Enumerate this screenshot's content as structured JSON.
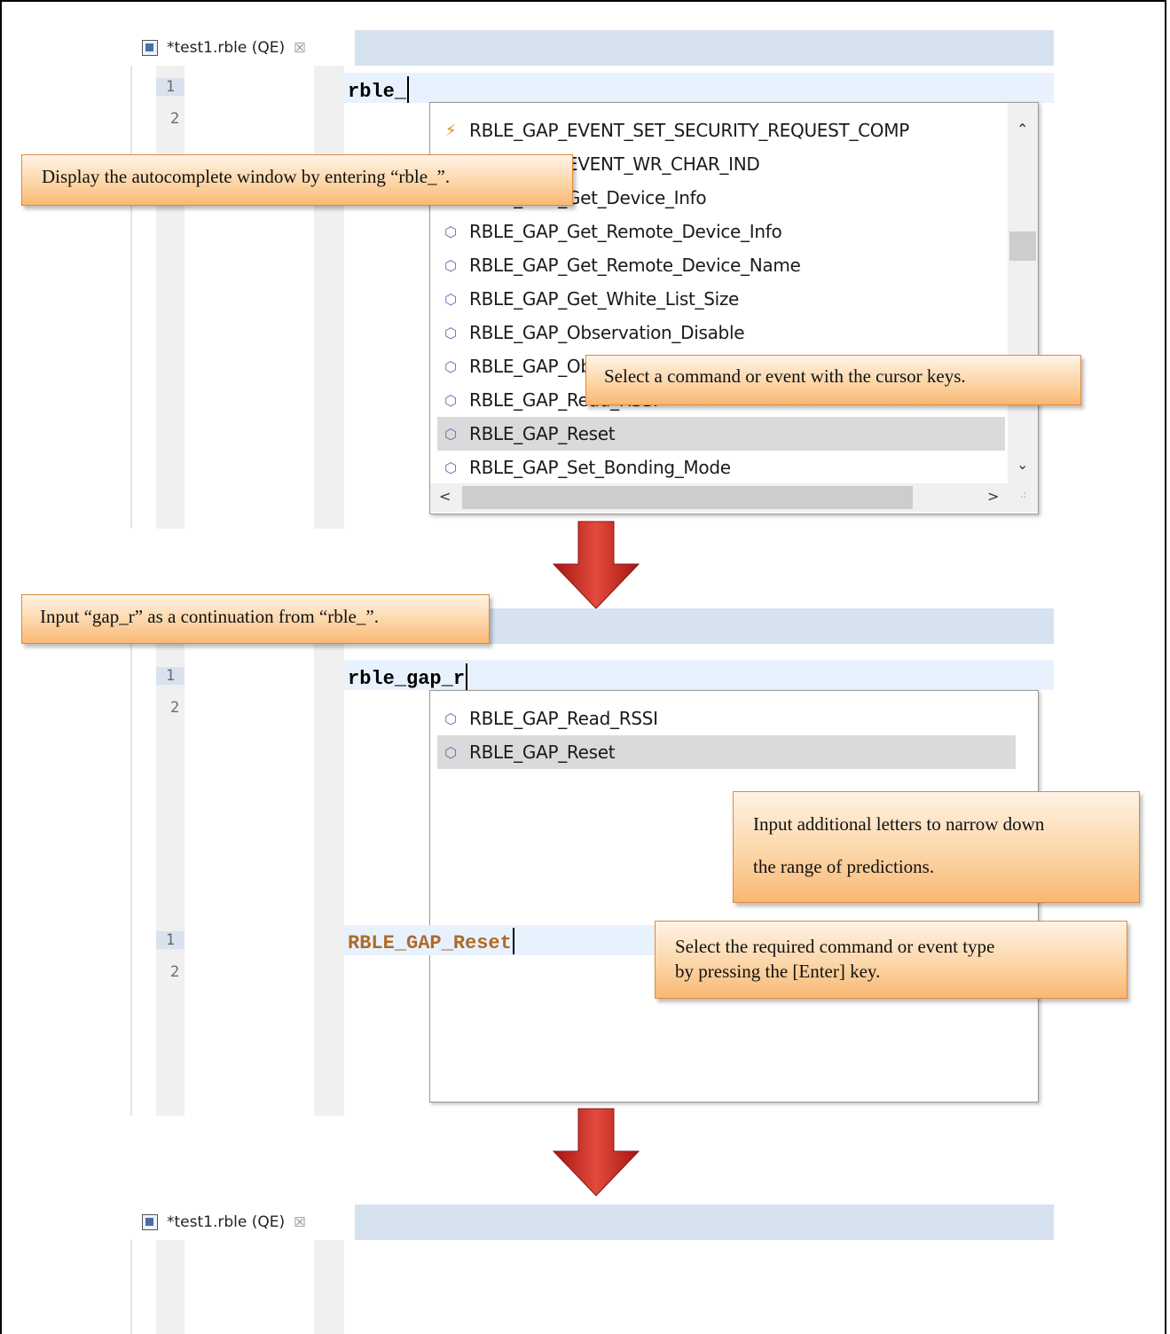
{
  "section1": {
    "tab_label": "*test1.rble (QE)",
    "tab_close": "☒",
    "line_numbers": [
      "1",
      "2"
    ],
    "code_text": "rble_",
    "popup_items": [
      {
        "icon": "bolt-icon",
        "label": "RBLE_GAP_EVENT_SET_SECURITY_REQUEST_COMP"
      },
      {
        "icon": "bolt-icon",
        "label": "RBLE_GAP_EVENT_WR_CHAR_IND"
      },
      {
        "icon": "cube-icon",
        "label": "RBLE_GAP_Get_Device_Info"
      },
      {
        "icon": "cube-icon",
        "label": "RBLE_GAP_Get_Remote_Device_Info"
      },
      {
        "icon": "cube-icon",
        "label": "RBLE_GAP_Get_Remote_Device_Name"
      },
      {
        "icon": "cube-icon",
        "label": "RBLE_GAP_Get_White_List_Size"
      },
      {
        "icon": "cube-icon",
        "label": "RBLE_GAP_Observation_Disable"
      },
      {
        "icon": "cube-icon",
        "label": "RBLE_GAP_Observation_Enable"
      },
      {
        "icon": "cube-icon",
        "label": "RBLE_GAP_Read_RSSI"
      },
      {
        "icon": "cube-icon",
        "label": "RBLE_GAP_Reset"
      },
      {
        "icon": "cube-icon",
        "label": "RBLE_GAP_Set_Bonding_Mode"
      }
    ],
    "selected_index": 9,
    "callout_top": "Display the autocomplete window by entering “rble_”.",
    "callout_select": "Select a command or event with the cursor keys."
  },
  "section2": {
    "callout_input": "Input “gap_r” as a continuation from “rble_”.",
    "line_numbers": [
      "1",
      "2"
    ],
    "code_text": "rble_gap_r",
    "popup_items": [
      {
        "icon": "cube-icon",
        "label": "RBLE_GAP_Read_RSSI"
      },
      {
        "icon": "cube-icon",
        "label": "RBLE_GAP_Reset"
      }
    ],
    "selected_index": 1,
    "callout_narrow_line1": "Input additional letters to narrow down",
    "callout_narrow_line2": "the range of predictions."
  },
  "section3": {
    "tab_label": "*test1.rble (QE)",
    "tab_close": "☒",
    "line_numbers": [
      "1",
      "2"
    ],
    "code_text": "RBLE_GAP_Reset",
    "callout_enter_line1": "Select the required command or event type",
    "callout_enter_line2": "by pressing the [Enter] key."
  },
  "colors": {
    "callout_border": "#e0893a",
    "arrow_red": "#c0201c",
    "selection": "#dadada",
    "tabbar": "#d6e2f0"
  }
}
